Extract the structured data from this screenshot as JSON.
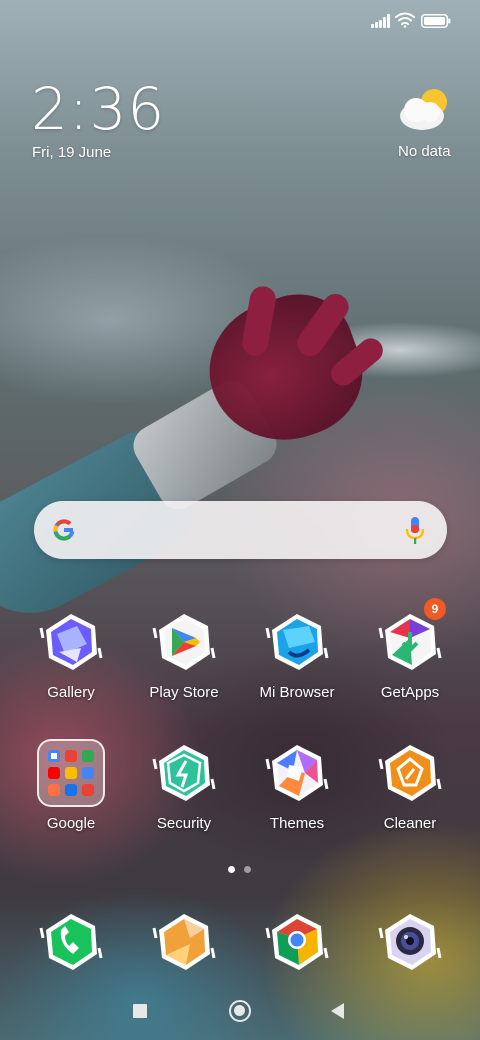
{
  "status_bar": {
    "signal_icon": "signal-bars-icon",
    "wifi_icon": "wifi-icon",
    "battery_icon": "battery-icon"
  },
  "clock": {
    "time": "2:36",
    "date": "Fri, 19 June"
  },
  "weather": {
    "icon": "partly-cloudy-icon",
    "text": "No data"
  },
  "search_bar": {
    "logo_icon": "google-g-icon",
    "mic_icon": "mic-icon"
  },
  "apps": {
    "row1": [
      {
        "label": "Gallery",
        "icon": "gallery-icon"
      },
      {
        "label": "Play Store",
        "icon": "play-store-icon"
      },
      {
        "label": "Mi Browser",
        "icon": "mi-browser-icon"
      },
      {
        "label": "GetApps",
        "icon": "getapps-icon",
        "badge": "9"
      }
    ],
    "row2": [
      {
        "label": "Google",
        "icon": "google-folder-icon"
      },
      {
        "label": "Security",
        "icon": "security-icon"
      },
      {
        "label": "Themes",
        "icon": "themes-icon"
      },
      {
        "label": "Cleaner",
        "icon": "cleaner-icon"
      }
    ]
  },
  "dock": [
    {
      "icon": "phone-icon"
    },
    {
      "icon": "messages-icon"
    },
    {
      "icon": "chrome-icon"
    },
    {
      "icon": "camera-icon"
    }
  ],
  "pager": {
    "pages": 2,
    "current": 1
  },
  "nav_bar": {
    "recent_icon": "recent-apps-icon",
    "home_icon": "home-icon",
    "back_icon": "back-icon"
  },
  "colors": {
    "badge": "#f05a24",
    "gallery": "#6b5cff",
    "play_store": "#34a853",
    "mi_browser": "#1aa3e8",
    "getapps": "#e8334a",
    "security": "#2ec29a",
    "themes": "#e9538f",
    "cleaner": "#ef8f1a",
    "phone": "#19c25a",
    "messages": "#f0a13a",
    "chrome": "#db4437",
    "camera": "#4a4e9a"
  }
}
